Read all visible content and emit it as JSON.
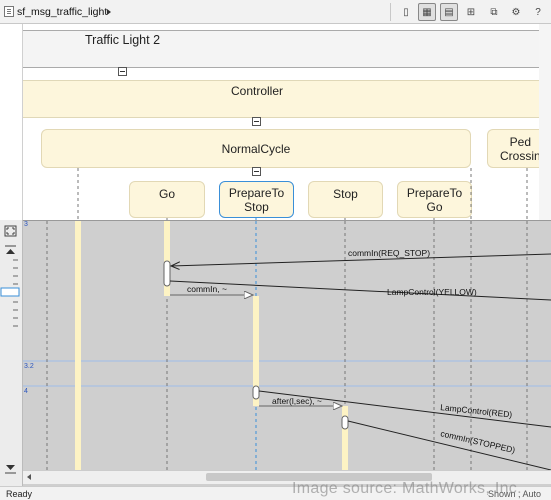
{
  "toolbar": {
    "breadcrumb": "sf_msg_traffic_light"
  },
  "header": {
    "chart_title": "Traffic Light 2",
    "controller_label": "Controller",
    "normal_cycle_label": "NormalCycle",
    "ped_crossing_label": "Ped\nCrossin",
    "states": [
      "Go",
      "PrepareTo\nStop",
      "Stop",
      "PrepareTo\nGo"
    ]
  },
  "timeline": {
    "segment_labels": [
      "3",
      "3.2",
      "4"
    ],
    "messages": [
      "commIn(REQ_STOP)",
      "LampControl(YELLOW)",
      "commIn, ~",
      "after(l,sec), ~",
      "LampControl(RED)",
      "commIn(STOPPED)"
    ]
  },
  "status": {
    "left": "Ready",
    "right": "Shown , Auto"
  },
  "watermark": "Image source:   MathWorks, Inc.",
  "colors": {
    "accent_blue": "#3a8fd8",
    "state_fill": "#fdf6dc",
    "timeline_bg": "#cfcfcf",
    "activation": "#fdf3c4"
  }
}
